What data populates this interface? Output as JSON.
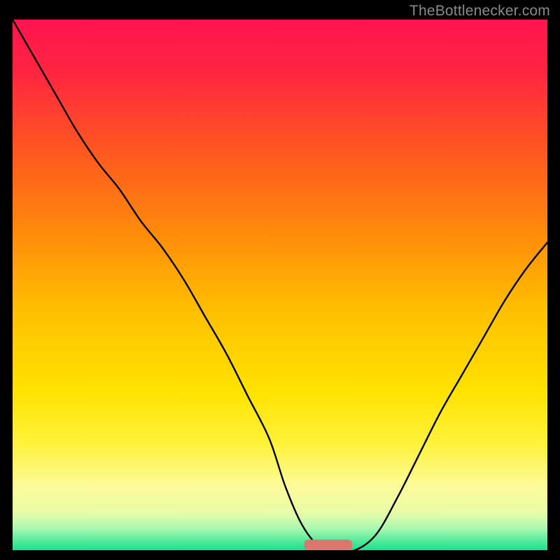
{
  "watermark": "TheBottlenecker.com",
  "chart_data": {
    "type": "line",
    "title": "",
    "xlabel": "",
    "ylabel": "",
    "xlim": [
      0,
      100
    ],
    "ylim": [
      0,
      100
    ],
    "axes_visible": false,
    "background_gradient": {
      "stops": [
        {
          "offset": 0.0,
          "color": "#ff1450"
        },
        {
          "offset": 0.1,
          "color": "#ff2540"
        },
        {
          "offset": 0.25,
          "color": "#ff5820"
        },
        {
          "offset": 0.4,
          "color": "#ff8a0b"
        },
        {
          "offset": 0.55,
          "color": "#ffc000"
        },
        {
          "offset": 0.7,
          "color": "#ffe200"
        },
        {
          "offset": 0.8,
          "color": "#fff23c"
        },
        {
          "offset": 0.88,
          "color": "#fdfb9a"
        },
        {
          "offset": 0.93,
          "color": "#e8fca8"
        },
        {
          "offset": 0.96,
          "color": "#a8f8b0"
        },
        {
          "offset": 0.985,
          "color": "#4be89a"
        },
        {
          "offset": 1.0,
          "color": "#18e28e"
        }
      ]
    },
    "series": [
      {
        "name": "bottleneck-curve",
        "x": [
          0,
          4,
          8,
          12,
          16,
          20,
          24,
          28,
          32,
          36,
          40,
          44,
          48,
          51,
          54,
          57,
          60,
          64,
          68,
          72,
          76,
          80,
          84,
          88,
          92,
          96,
          100
        ],
        "y": [
          100,
          93,
          86,
          79,
          73,
          68,
          62,
          57,
          51,
          44,
          37,
          29,
          21,
          12,
          5,
          1,
          0,
          0,
          3,
          10,
          18,
          26,
          33,
          40,
          47,
          53,
          58
        ]
      }
    ],
    "marker": {
      "name": "optimal-range-marker",
      "x_center": 59,
      "width": 9,
      "height": 2.0,
      "color": "#da7870"
    }
  }
}
